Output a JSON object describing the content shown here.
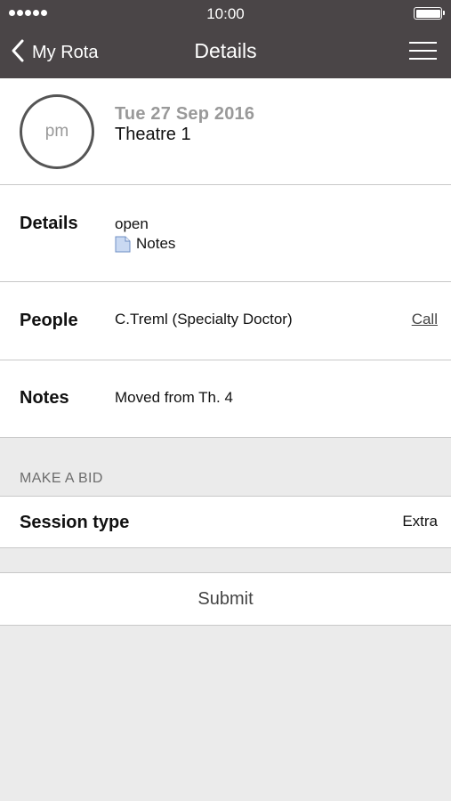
{
  "status_bar": {
    "time": "10:00"
  },
  "nav": {
    "back_label": "My Rota",
    "title": "Details"
  },
  "session": {
    "badge": "pm",
    "date": "Tue 27 Sep 2016",
    "location": "Theatre 1"
  },
  "details": {
    "label": "Details",
    "status": "open",
    "notes_link": "Notes"
  },
  "people": {
    "label": "People",
    "name": "C.Treml (Specialty Doctor)",
    "action": "Call"
  },
  "notes": {
    "label": "Notes",
    "text": "Moved from Th. 4"
  },
  "bid": {
    "section_title": "MAKE A BID",
    "session_type_label": "Session type",
    "session_type_value": "Extra",
    "submit_label": "Submit"
  },
  "colors": {
    "nav_background": "#4a4547",
    "page_background": "#ebebeb"
  },
  "icons": [
    "back-chevron-icon",
    "menu-icon",
    "document-icon",
    "battery-icon",
    "signal-icon"
  ]
}
